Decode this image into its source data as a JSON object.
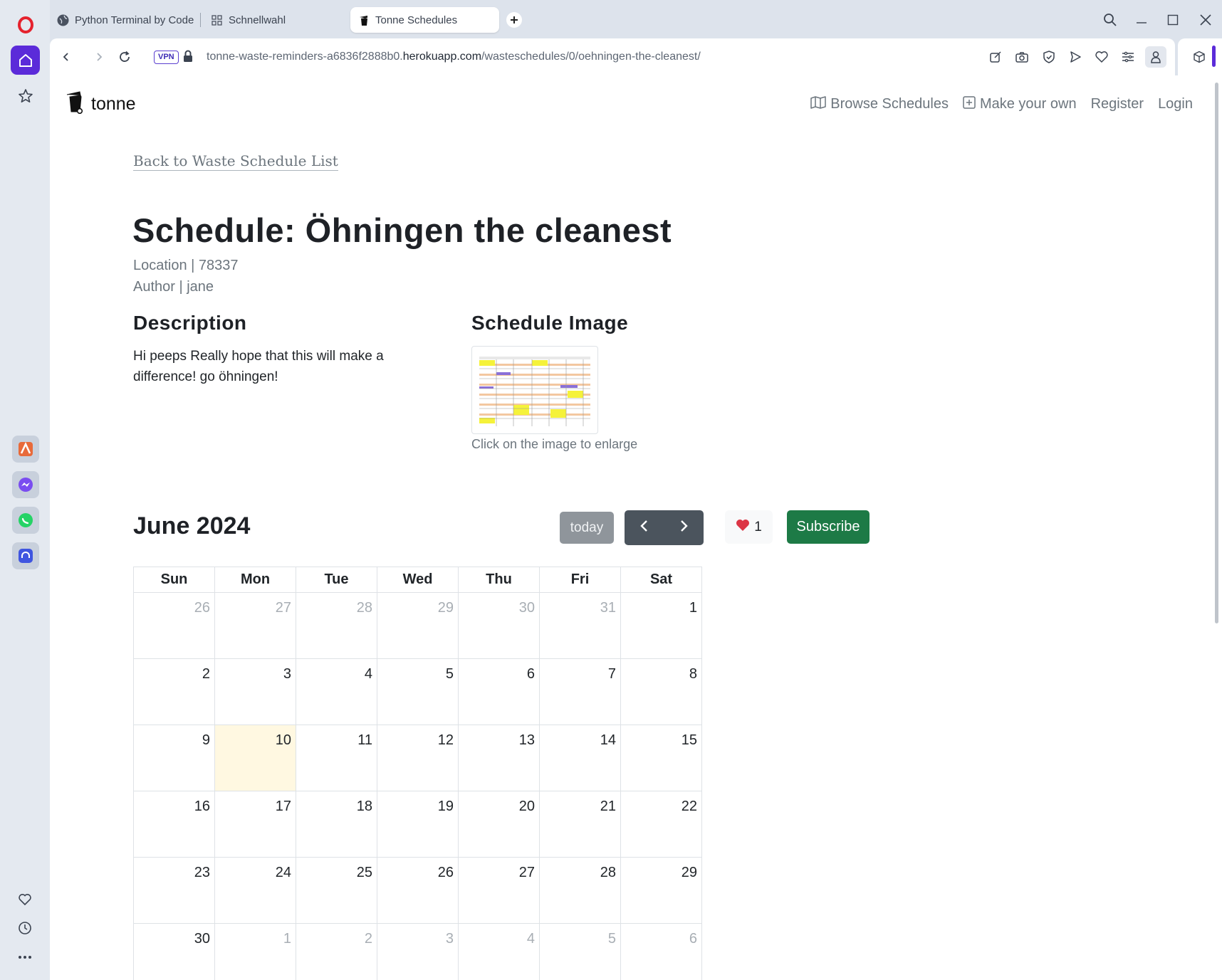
{
  "browser": {
    "tabs": [
      {
        "label": "Python Terminal by Code I",
        "icon": "globe-icon"
      },
      {
        "label": "Schnellwahl",
        "icon": "grid-icon"
      },
      {
        "label": "Tonne Schedules",
        "icon": "tonne-favicon",
        "active": true
      }
    ],
    "vpn_label": "VPN",
    "url_prefix": "tonne-waste-reminders-a6836f2888b0.",
    "url_domain": "herokuapp.com",
    "url_path": "/wasteschedules/0/oehningen-the-cleanest/"
  },
  "site": {
    "brand": "tonne",
    "nav": {
      "browse": "Browse Schedules",
      "make": "Make your own",
      "register": "Register",
      "login": "Login"
    }
  },
  "schedule": {
    "back_link": "Back to Waste Schedule List",
    "title": "Schedule: Öhningen the cleanest",
    "location": "Location | 78337",
    "author": "Author | jane",
    "description_heading": "Description",
    "description": "Hi peeps Really hope that this will make a difference! go öhningen!",
    "image_heading": "Schedule Image",
    "image_caption": "Click on the image to enlarge"
  },
  "calendar": {
    "title": "June 2024",
    "today_label": "today",
    "likes": "1",
    "subscribe_label": "Subscribe",
    "weekdays": [
      "Sun",
      "Mon",
      "Tue",
      "Wed",
      "Thu",
      "Fri",
      "Sat"
    ],
    "weeks": [
      [
        "26",
        "27",
        "28",
        "29",
        "30",
        "31",
        "1"
      ],
      [
        "2",
        "3",
        "4",
        "5",
        "6",
        "7",
        "8"
      ],
      [
        "9",
        "10",
        "11",
        "12",
        "13",
        "14",
        "15"
      ],
      [
        "16",
        "17",
        "18",
        "19",
        "20",
        "21",
        "22"
      ],
      [
        "23",
        "24",
        "25",
        "26",
        "27",
        "28",
        "29"
      ],
      [
        "30",
        "1",
        "2",
        "3",
        "4",
        "5",
        "6"
      ]
    ]
  },
  "colors": {
    "accent": "#5b2bd9",
    "subscribe": "#1d7a46",
    "today_bg": "#fff8e1",
    "like": "#dc3545"
  }
}
